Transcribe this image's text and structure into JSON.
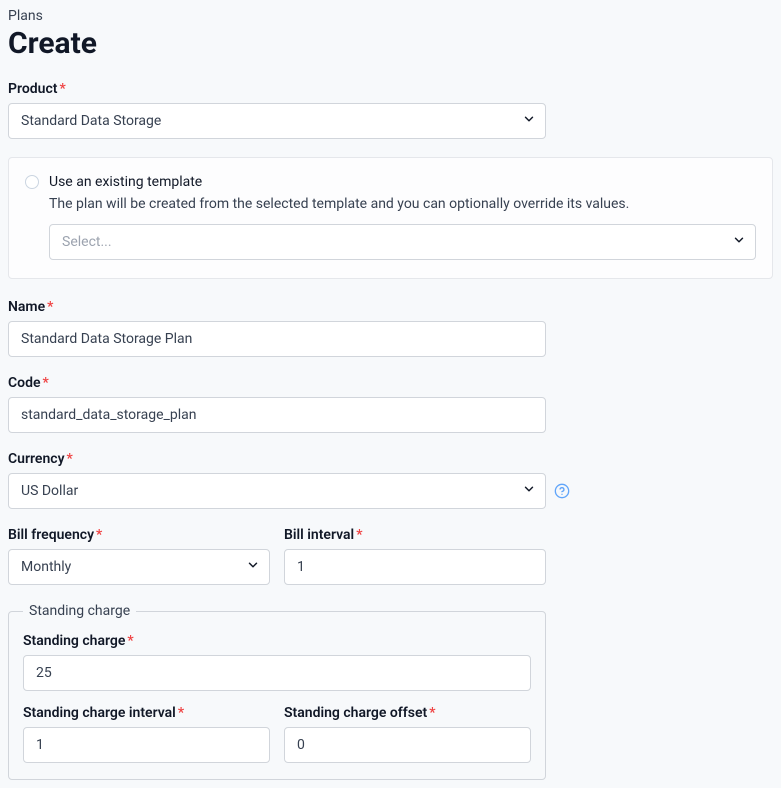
{
  "breadcrumb": "Plans",
  "page_title": "Create",
  "product": {
    "label": "Product",
    "value": "Standard Data Storage"
  },
  "template": {
    "radio_label": "Use an existing template",
    "description": "The plan will be created from the selected template and you can optionally override its values.",
    "placeholder": "Select..."
  },
  "name": {
    "label": "Name",
    "value": "Standard Data Storage Plan"
  },
  "code": {
    "label": "Code",
    "value": "standard_data_storage_plan"
  },
  "currency": {
    "label": "Currency",
    "value": "US Dollar"
  },
  "bill_frequency": {
    "label": "Bill frequency",
    "value": "Monthly"
  },
  "bill_interval": {
    "label": "Bill interval",
    "value": "1"
  },
  "standing": {
    "legend": "Standing charge",
    "charge": {
      "label": "Standing charge",
      "value": "25"
    },
    "interval": {
      "label": "Standing charge interval",
      "value": "1"
    },
    "offset": {
      "label": "Standing charge offset",
      "value": "0"
    }
  }
}
